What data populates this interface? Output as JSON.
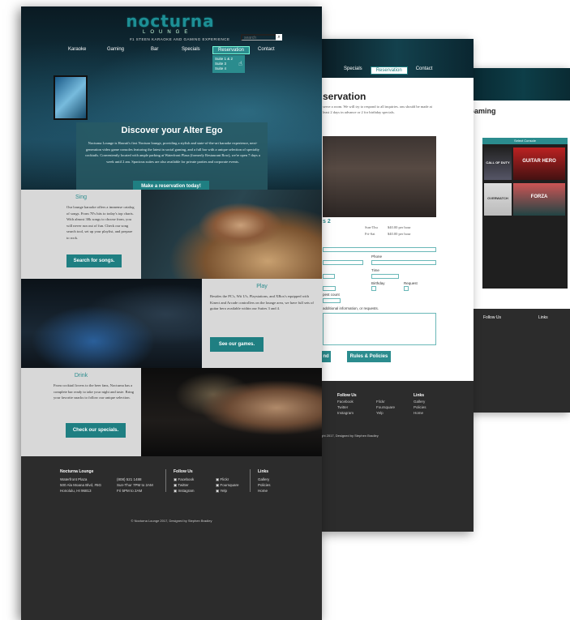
{
  "brand": {
    "logo": "nocturna",
    "sub": "LOUNGE",
    "tagline": "#1 STEEN KARAOKE AND GAMING EXPERIENCE"
  },
  "search": {
    "placeholder": "search",
    "button_icon": "search-icon"
  },
  "nav": {
    "items": [
      "Karaoke",
      "Gaming",
      "Bar",
      "Specials",
      "Reservation",
      "Contact"
    ],
    "active": "Reservation",
    "dropdown": [
      "Suite 1 & 2",
      "Suite 3",
      "Suite 4"
    ]
  },
  "hero": {
    "title": "Discover your Alter Ego",
    "body": "Nocturna Lounge is Hawaii's first Nocturn lounge, providing a stylish and state-of-the-art karaoke experience, next-generation video game consoles featuring the latest in social gaming, and a full bar with a unique selection of specialty cocktails. Conveniently located with ample parking at Waterfront Plaza (formerly Restaurant Row), we're open 7 days a week until 2 am. Spacious suites are also available for private parties and corporate events.",
    "button": "Make a reservation today!"
  },
  "sing": {
    "title": "Sing",
    "body": "Our lounge karaoke offers a immense catalog of songs. From 70's hits to today's top charts. With almost 30k songs to choose from, you will never run out of fun. Check our song search tool, set up your playlist, and prepare to rock.",
    "button": "Search for songs."
  },
  "play": {
    "title": "Play",
    "body": "Besides the PC's, Wii U's, Playstations, and XBox's equipped with Kinect and Arcade controllers on the lounge area, we have full sets of guitar hero available within our Suites 3 and 4.",
    "button": "See our games."
  },
  "drink": {
    "title": "Drink",
    "body": "From cocktail lovers to the beer fans, Nocturna has a complete bar ready to take your night and taste. Bring your favorite snacks to follow our unique selection.",
    "button": "Check our specials."
  },
  "footer": {
    "name": "Nocturna Lounge",
    "address": [
      "Waterfront Plaza",
      "500 Ala Moana Blvd, #5G",
      "Honolulu, HI 96813"
    ],
    "hours": [
      "(808) 521 1488",
      "Sun-Thur 7PM to 2AM",
      "Fri 5PM to 2AM"
    ],
    "follow_title": "Follow Us",
    "social": [
      "Facebook",
      "Twitter",
      "Instagram",
      "Flickr",
      "Foursquare",
      "Yelp"
    ],
    "links_title": "Links",
    "links": [
      "Gallery",
      "Policies",
      "Home"
    ],
    "copyright": "© Nocturna Lounge 2017, Designed by Stephen Bradley"
  },
  "page2": {
    "nav": [
      "Specials",
      "Reservation",
      "Contact"
    ],
    "title": "servation",
    "intro": "serve a room. We will try to respond to all inquiries. ons should be made at least 2 days in advance or 2 for birthday specials.",
    "suite": "s 2",
    "labels": [
      "Phone",
      "Time",
      "Birthday",
      "Request",
      "pest count",
      "additional information, or requests."
    ],
    "prices": [
      "Sun-Thu",
      "Fri-Sat",
      "$40.00 per hour",
      "$40.00 per hour"
    ],
    "buttons": [
      "nd",
      "Rules & Policies"
    ],
    "footer": {
      "follow": "Follow Us",
      "links": "Links",
      "social": [
        "Facebook",
        "Twitter",
        "Instagram",
        "Flickr",
        "Foursquare",
        "Yelp"
      ],
      "link_items": [
        "Gallery",
        "Policies",
        "Home"
      ],
      "copy": "ght 2017, Designed by Stephen Bradley"
    }
  },
  "page3": {
    "title": "Gaming",
    "carousel_label": "Select Console",
    "tiles": [
      "CALL OF DUTY",
      "GUITAR HERO",
      "OVERWATCH",
      "FORZA"
    ],
    "follow": "Follow Us",
    "links": "Links"
  }
}
